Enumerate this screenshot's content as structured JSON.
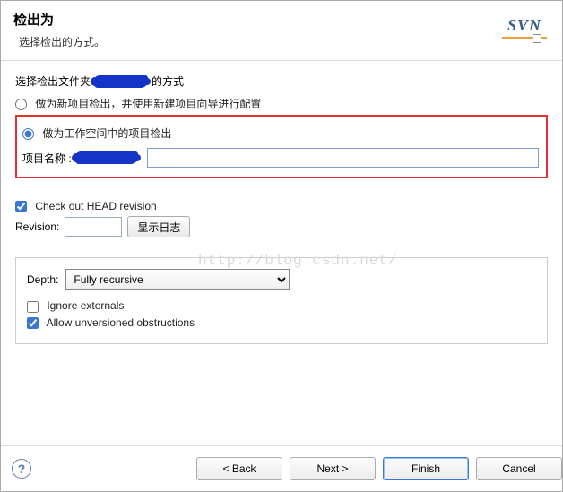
{
  "header": {
    "title": "检出为",
    "subtitle": "选择检出的方式。",
    "logo_text": "SVN"
  },
  "content": {
    "folder_line_prefix": "选择检出文件夹",
    "folder_line_suffix": "的方式",
    "radio1": "做为新项目检出，并使用新建项目向导进行配置",
    "radio2": "做为工作空间中的项目检出",
    "project_name_label": "项目名称 :",
    "checkout_head": "Check out HEAD revision",
    "revision_label": "Revision:",
    "show_log_btn": "显示日志",
    "depth_label": "Depth:",
    "depth_options": [
      "Fully recursive"
    ],
    "depth_value": "Fully recursive",
    "ignore_externals": "Ignore externals",
    "allow_unversioned": "Allow unversioned obstructions"
  },
  "watermark": "http://blog.csdn.net/",
  "footer": {
    "back": "< Back",
    "next": "Next >",
    "finish": "Finish",
    "cancel": "Cancel"
  }
}
